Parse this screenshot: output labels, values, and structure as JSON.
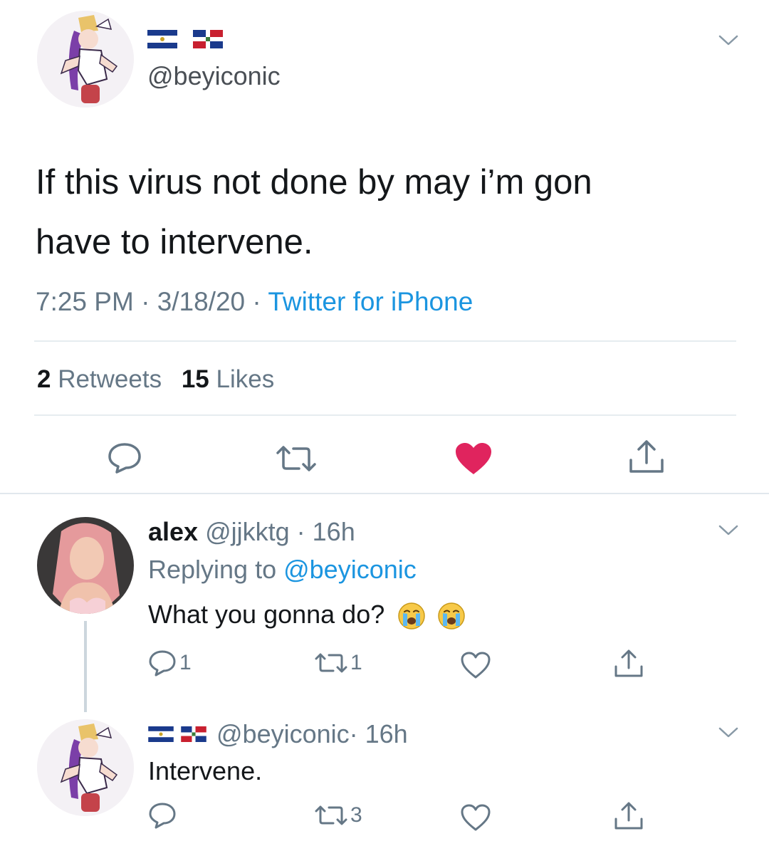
{
  "main_tweet": {
    "handle": "@beyiconic",
    "flags": [
      "el-salvador-flag",
      "dominican-republic-flag"
    ],
    "text_line1": "If this virus not done by may i’m gon",
    "text_line2": "have to intervene.",
    "time": "7:25 PM",
    "sep1": " · ",
    "date": "3/18/20",
    "sep2": " · ",
    "source": "Twitter for iPhone",
    "retweets_count": "2",
    "retweets_label": " Retweets",
    "likes_count": "15",
    "likes_label": " Likes",
    "liked": true,
    "heart_color": "#e0245e"
  },
  "reply1": {
    "name": "alex",
    "handle": "@jjkktg",
    "time": " · 16h",
    "replying_prefix": "Replying to ",
    "replying_handle": "@beyiconic",
    "text": "What you gonna do?",
    "emoji": [
      "crying-face-icon",
      "crying-face-icon"
    ],
    "reply_count": "1",
    "retweet_count": "1"
  },
  "reply2": {
    "handle": "@beyiconic",
    "time": " · 16h",
    "text": "Intervene.",
    "retweet_count": "3"
  },
  "colors": {
    "accent": "#1b95e0",
    "muted": "#657786",
    "divider": "#e6ecf0",
    "like": "#e0245e"
  }
}
